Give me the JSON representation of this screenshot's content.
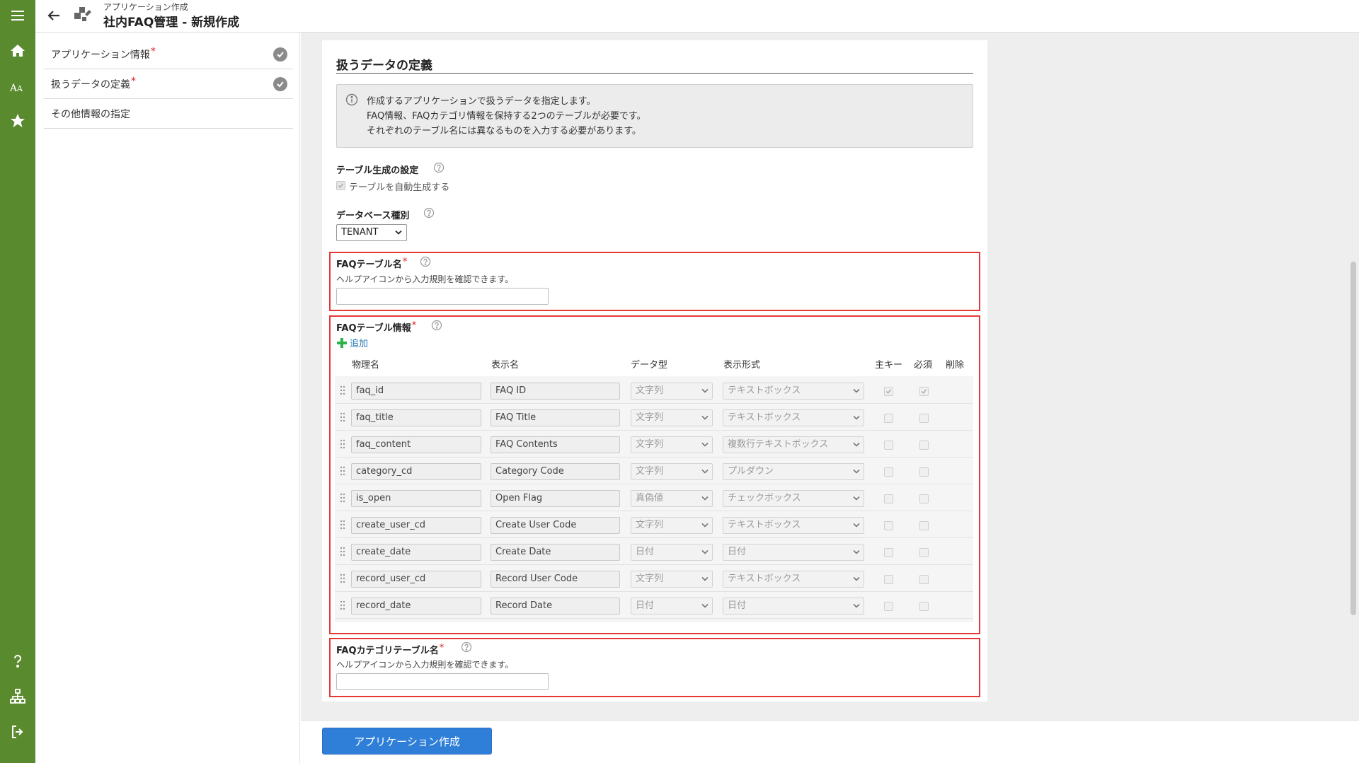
{
  "header": {
    "breadcrumb": "アプリケーション作成",
    "title": "社内FAQ管理 - 新規作成"
  },
  "steps": [
    {
      "label": "アプリケーション情報",
      "required": "*",
      "done": true
    },
    {
      "label": "扱うデータの定義",
      "required": "*",
      "done": true
    },
    {
      "label": "その他情報の指定",
      "required": "",
      "done": false
    }
  ],
  "section": {
    "title": "扱うデータの定義",
    "info_lines": [
      "作成するアプリケーションで扱うデータを指定します。",
      "FAQ情報、FAQカテゴリ情報を保持する2つのテーブルが必要です。",
      "それぞれのテーブル名には異なるものを入力する必要があります。"
    ]
  },
  "table_generation": {
    "label": "テーブル生成の設定",
    "checkbox_label": "テーブルを自動生成する"
  },
  "db_type": {
    "label": "データベース種別",
    "value": "TENANT"
  },
  "faq_table_name": {
    "label": "FAQテーブル名",
    "required": "*",
    "hint": "ヘルプアイコンから入力規則を確認できます。",
    "value": ""
  },
  "faq_table_info": {
    "label": "FAQテーブル情報",
    "required": "*",
    "add_label": "追加",
    "columns": [
      "物理名",
      "表示名",
      "データ型",
      "表示形式",
      "主キー",
      "必須",
      "削除"
    ],
    "rows": [
      {
        "physical": "faq_id",
        "display": "FAQ ID",
        "type": "文字列",
        "format": "テキストボックス",
        "pk": true,
        "required": true
      },
      {
        "physical": "faq_title",
        "display": "FAQ Title",
        "type": "文字列",
        "format": "テキストボックス",
        "pk": false,
        "required": false
      },
      {
        "physical": "faq_content",
        "display": "FAQ Contents",
        "type": "文字列",
        "format": "複数行テキストボックス",
        "pk": false,
        "required": false
      },
      {
        "physical": "category_cd",
        "display": "Category Code",
        "type": "文字列",
        "format": "プルダウン",
        "pk": false,
        "required": false
      },
      {
        "physical": "is_open",
        "display": "Open Flag",
        "type": "真偽値",
        "format": "チェックボックス",
        "pk": false,
        "required": false
      },
      {
        "physical": "create_user_cd",
        "display": "Create User Code",
        "type": "文字列",
        "format": "テキストボックス",
        "pk": false,
        "required": false
      },
      {
        "physical": "create_date",
        "display": "Create Date",
        "type": "日付",
        "format": "日付",
        "pk": false,
        "required": false
      },
      {
        "physical": "record_user_cd",
        "display": "Record User Code",
        "type": "文字列",
        "format": "テキストボックス",
        "pk": false,
        "required": false
      },
      {
        "physical": "record_date",
        "display": "Record Date",
        "type": "日付",
        "format": "日付",
        "pk": false,
        "required": false
      }
    ]
  },
  "faq_category_table_name": {
    "label": "FAQカテゴリテーブル名",
    "required": "*",
    "hint": "ヘルプアイコンから入力規則を確認できます。",
    "value": ""
  },
  "footer": {
    "create_button": "アプリケーション作成"
  },
  "colors": {
    "rail": "#5a8a2e",
    "primary": "#2f7fd8",
    "highlight": "#e53935",
    "required": "#e02020"
  }
}
